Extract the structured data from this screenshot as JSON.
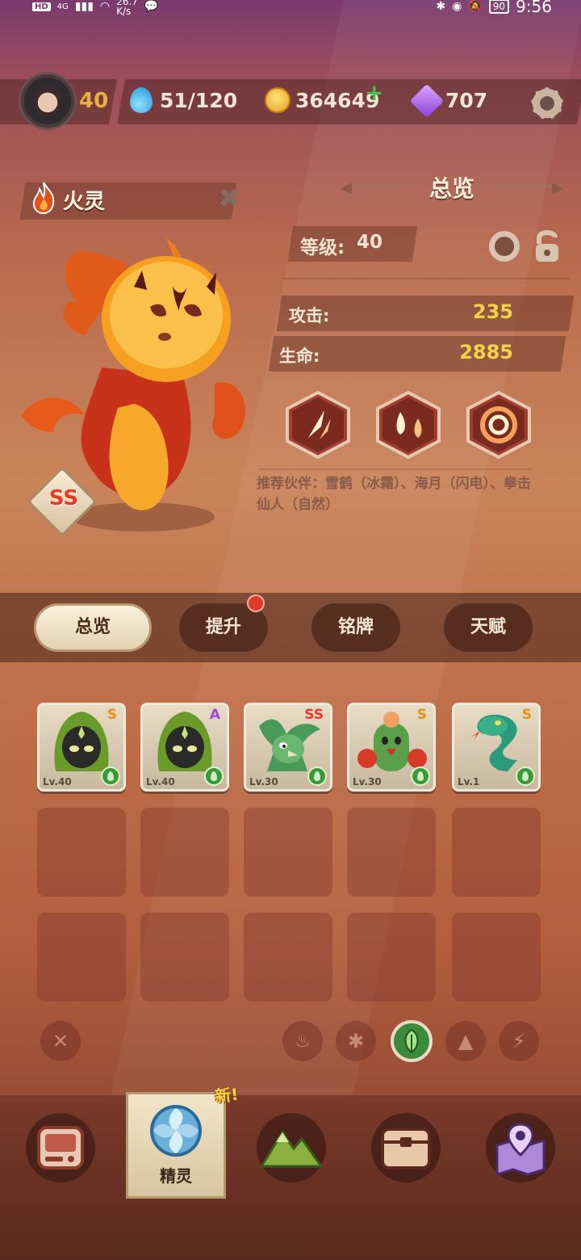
{
  "status_bar": {
    "hd": "HD",
    "net": "4G",
    "speed": "26.7\nK/s",
    "battery": "90",
    "time": "9:56"
  },
  "player": {
    "level": "40",
    "stamina": "51/120",
    "coins": "364649",
    "gems": "707"
  },
  "monster": {
    "name": "火灵",
    "grade": "SS"
  },
  "overview": {
    "title": "总览",
    "level_label": "等级:",
    "level_value": "40",
    "attack_label": "攻击:",
    "attack_value": "235",
    "hp_label": "生命:",
    "hp_value": "2885",
    "partners": "推荐伙伴：雪鹤（冰霜）、海月（闪电）、拳击仙人（自然）"
  },
  "skills": [
    "claw-strike-icon",
    "fire-drops-icon",
    "fire-swirl-icon"
  ],
  "tabs": [
    {
      "label": "总览",
      "active": true
    },
    {
      "label": "提升",
      "active": false,
      "notify": true
    },
    {
      "label": "铭牌",
      "active": false
    },
    {
      "label": "天赋",
      "active": false
    }
  ],
  "roster": [
    {
      "grade": "S",
      "grade_color": "#e8901a",
      "level": "Lv.40",
      "element": "nature",
      "icon": "hooded-green-spirit"
    },
    {
      "grade": "A",
      "grade_color": "#a048d8",
      "level": "Lv.40",
      "element": "nature",
      "icon": "hooded-green-spirit"
    },
    {
      "grade": "SS",
      "grade_color": "#e83a2a",
      "level": "Lv.30",
      "element": "nature",
      "icon": "green-crane"
    },
    {
      "grade": "S",
      "grade_color": "#e8901a",
      "level": "Lv.30",
      "element": "nature",
      "icon": "cactus-boxer"
    },
    {
      "grade": "S",
      "grade_color": "#e8901a",
      "level": "Lv.1",
      "element": "nature",
      "icon": "green-serpent"
    }
  ],
  "filters": [
    {
      "icon": "clear-icon",
      "glyph": "✕",
      "active": false
    },
    {
      "icon": "fire-icon",
      "glyph": "🔥",
      "active": false
    },
    {
      "icon": "frost-icon",
      "glyph": "✱",
      "active": false
    },
    {
      "icon": "leaf-icon",
      "glyph": "",
      "active": true
    },
    {
      "icon": "rock-icon",
      "glyph": "▲",
      "active": false
    },
    {
      "icon": "lightning-icon",
      "glyph": "⚡",
      "active": false
    }
  ],
  "bottom_nav": [
    {
      "icon": "console-icon",
      "label": ""
    },
    {
      "icon": "spirit-orb-icon",
      "label": "精灵",
      "active": true,
      "badge": "新!"
    },
    {
      "icon": "mountain-icon",
      "label": ""
    },
    {
      "icon": "chest-icon",
      "label": ""
    },
    {
      "icon": "map-pin-icon",
      "label": ""
    }
  ],
  "colors": {
    "accent_gold": "#f6d24a",
    "grade_ss": "#e83a2a",
    "nature_green": "#3a9a3a"
  }
}
